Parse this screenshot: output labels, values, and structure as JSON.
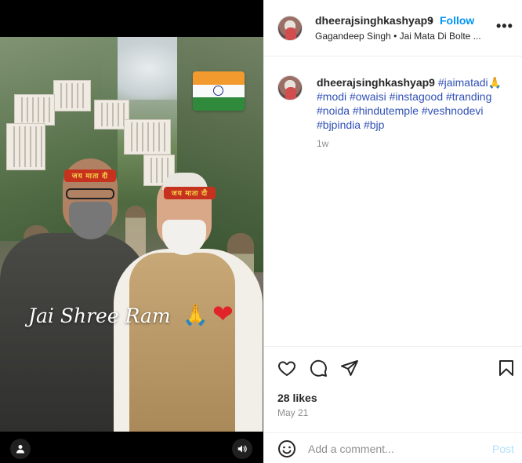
{
  "post": {
    "username": "dheerajsinghkashyap9",
    "follow_label": "Follow",
    "separator": "•",
    "subline": "Gagandeep Singh • Jai Mata Di Bolte ...",
    "more_label": "•••"
  },
  "media": {
    "overlay_text": "Jai Shree Ram",
    "overlay_emoji_pray": "🙏",
    "overlay_emoji_heart": "❤",
    "headband_text_left": "जय माता दी",
    "headband_text_right": "जय माता दी"
  },
  "caption": {
    "username": "dheerajsinghkashyap9",
    "hashtags_line1": "#jaimatadi",
    "emoji": "🙏",
    "hashtags_line2": "#modi #owaisi #instagood #tranding",
    "hashtags_line3": "#noida #hindutemple #veshnodevi",
    "hashtags_line4": "#bjpindia #bjp",
    "time_ago": "1w"
  },
  "engagement": {
    "likes": "28 likes",
    "date": "May 21"
  },
  "comment": {
    "placeholder": "Add a comment...",
    "post_label": "Post"
  },
  "colors": {
    "accent": "#0095f6",
    "hashtag": "#3050b6",
    "post_disabled": "#b2dffc",
    "muted": "#8e8e8e"
  },
  "icons": [
    "user-tag-icon",
    "volume-icon",
    "heart-icon",
    "comment-icon",
    "share-icon",
    "bookmark-icon",
    "emoji-icon",
    "more-icon",
    "india-flag"
  ]
}
